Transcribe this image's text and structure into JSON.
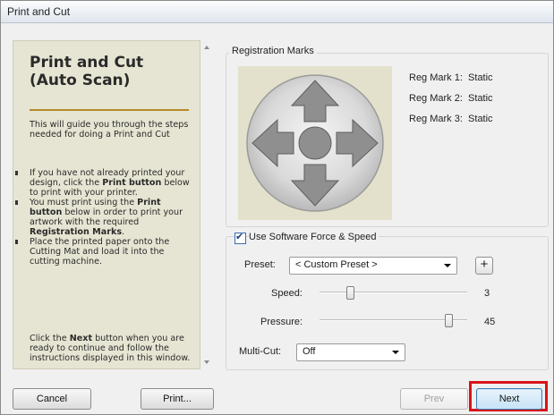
{
  "window": {
    "title": "Print and Cut"
  },
  "help": {
    "heading_line1": "Print and Cut",
    "heading_line2": "(Auto Scan)",
    "intro": "This will guide you through the steps needed for doing a Print and Cut",
    "bullets": [
      {
        "before": "If you have not already printed your design, click the ",
        "bold": "Print button",
        "after": " below to print with your printer."
      },
      {
        "before": "You must print using the ",
        "bold": "Print button",
        "after": " below in order to print your artwork with the required ",
        "bold2": "Registration Marks",
        "after2": "."
      },
      {
        "before": "Place the printed paper onto the Cutting Mat and load it into the cutting machine.",
        "bold": "",
        "after": ""
      }
    ],
    "outro_before": "Click the ",
    "outro_bold": "Next",
    "outro_after": " button when you are ready to continue and follow the instructions displayed in this window."
  },
  "registration": {
    "group_title": "Registration Marks",
    "marks": [
      {
        "label": "Reg Mark 1:",
        "status": "Static"
      },
      {
        "label": "Reg Mark 2:",
        "status": "Static"
      },
      {
        "label": "Reg Mark 3:",
        "status": "Static"
      }
    ]
  },
  "settings": {
    "use_software_label": "Use Software Force  & Speed",
    "use_software_checked": true,
    "preset_label": "Preset:",
    "preset_value": "< Custom Preset >",
    "add_preset_symbol": "+",
    "speed_label": "Speed:",
    "speed_value": "3",
    "speed_fraction": 0.19,
    "pressure_label": "Pressure:",
    "pressure_value": "45",
    "pressure_fraction": 0.9,
    "multicut_label": "Multi-Cut:",
    "multicut_value": "Off"
  },
  "buttons": {
    "cancel": "Cancel",
    "print": "Print...",
    "prev": "Prev",
    "next": "Next"
  },
  "colors": {
    "highlight": "#d8141a",
    "help_background": "#e6e5d3",
    "help_rule": "#b58a2a",
    "arrow_fill": "#8f8f8f"
  }
}
